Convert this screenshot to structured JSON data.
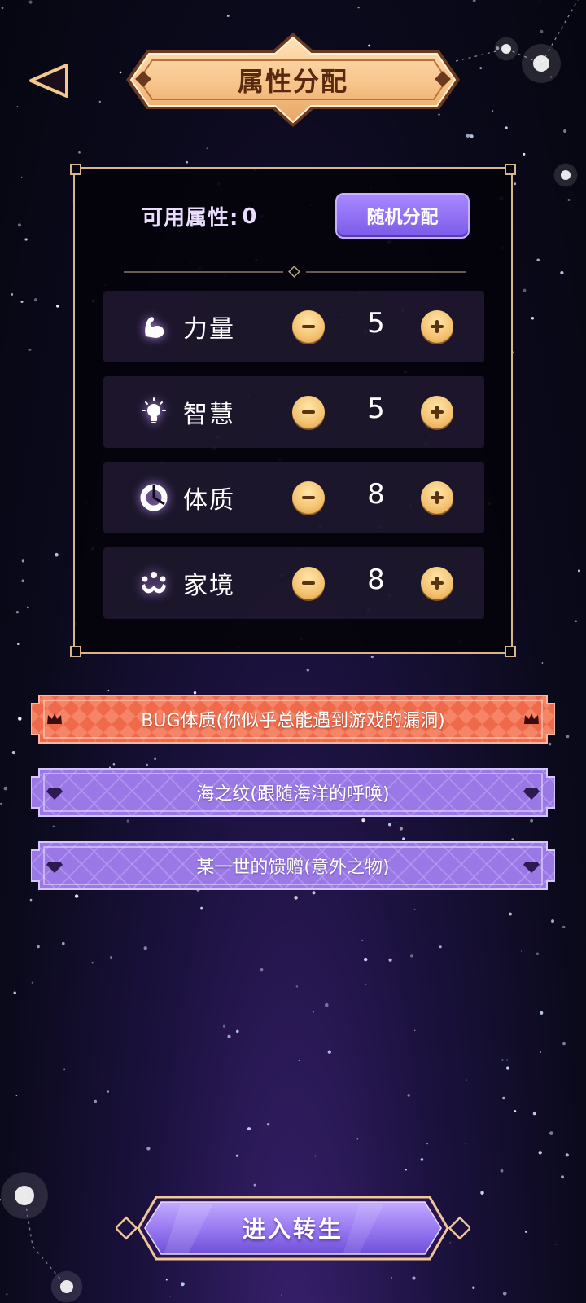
{
  "header": {
    "title": "属性分配",
    "back_icon": "triangle-back-icon"
  },
  "panel": {
    "available_label": "可用属性:",
    "available_points": "0",
    "random_button_label": "随机分配"
  },
  "attributes": [
    {
      "name": "力量",
      "value": "5",
      "icon": "muscle-arm-icon"
    },
    {
      "name": "智慧",
      "value": "5",
      "icon": "lightbulb-icon"
    },
    {
      "name": "体质",
      "value": "8",
      "icon": "constitution-ring-icon"
    },
    {
      "name": "家境",
      "value": "8",
      "icon": "family-icon"
    }
  ],
  "talents": [
    {
      "text": "BUG体质(你似乎总能遇到游戏的漏洞)",
      "rarity": "legendary",
      "icon": "crown-icon",
      "color": "#ef6a4a"
    },
    {
      "text": "海之纹(跟随海洋的呼唤)",
      "rarity": "epic",
      "icon": "diamond-icon",
      "color": "#9a78e6"
    },
    {
      "text": "某一世的馈赠(意外之物)",
      "rarity": "epic",
      "icon": "diamond-icon",
      "color": "#9a78e6"
    }
  ],
  "footer": {
    "start_button_label": "进入转生"
  },
  "colors": {
    "gold": "#f6c98f",
    "gold_border": "#d8b58f",
    "purple_button": "#8a6cf0",
    "legendary": "#ef6a4a",
    "epic": "#9a78e6"
  }
}
